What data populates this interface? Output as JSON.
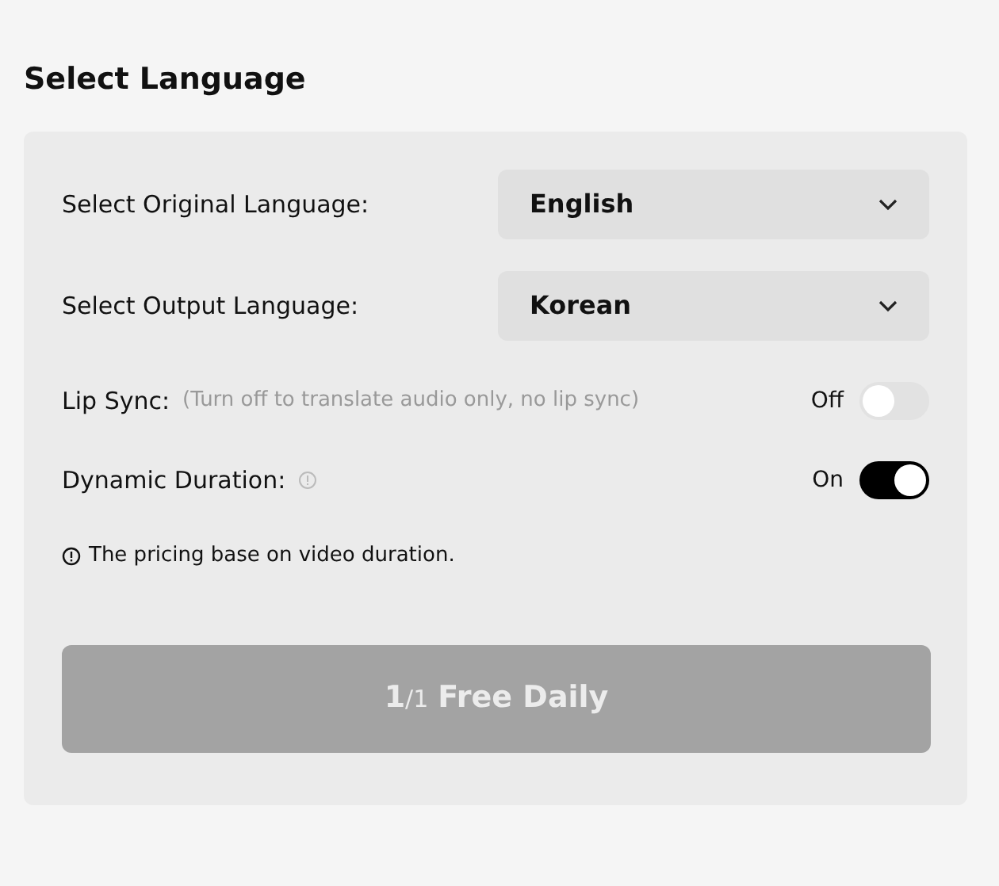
{
  "title": "Select Language",
  "dropdowns": [
    {
      "label": "Select Original Language:",
      "value": "English"
    },
    {
      "label": "Select Output Language:",
      "value": "Korean"
    }
  ],
  "toggles": [
    {
      "label": "Lip Sync:",
      "hint": "(Turn off to translate audio only, no lip sync)",
      "info_icon": false,
      "state_text": "Off",
      "on": false
    },
    {
      "label": "Dynamic Duration:",
      "info_icon": true,
      "state_text": "On",
      "on": true
    }
  ],
  "note": "The pricing base on video duration.",
  "button": {
    "used": "1",
    "total": "/1",
    "label": "Free Daily",
    "disabled": true
  }
}
